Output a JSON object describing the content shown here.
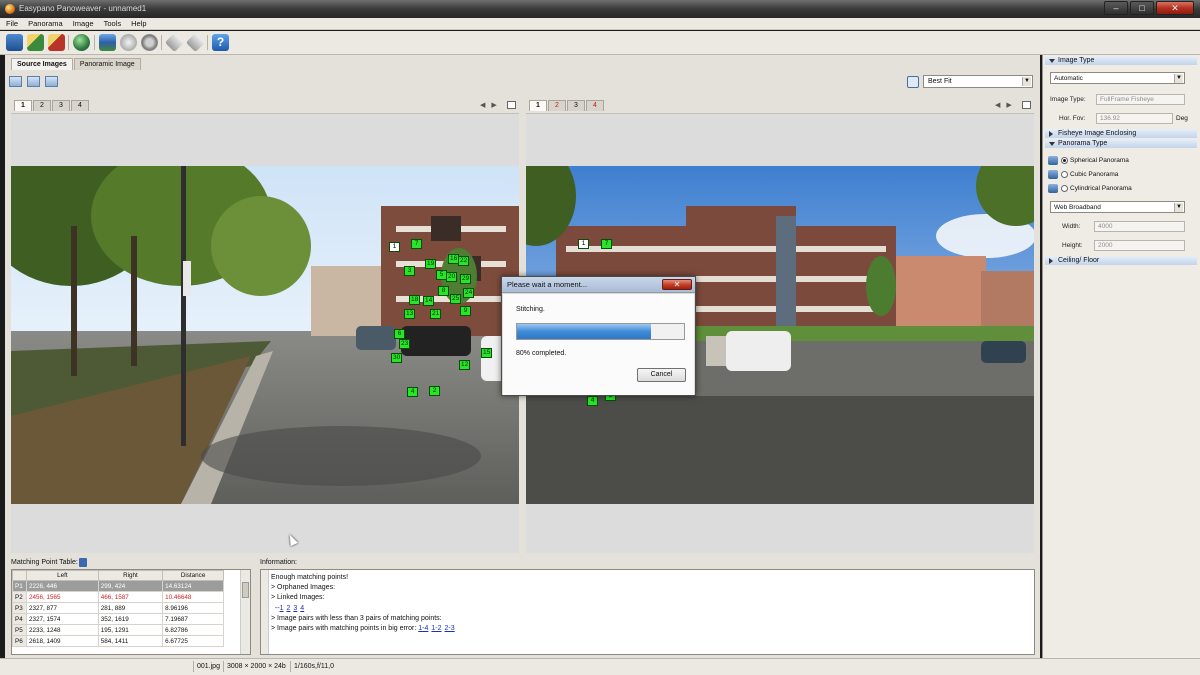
{
  "window": {
    "title": "Easypano Panoweaver - unnamed1",
    "minimize": "–",
    "maximize": "□",
    "close": "✕"
  },
  "menu": [
    "File",
    "Panorama",
    "Image",
    "Tools",
    "Help"
  ],
  "toolbar": {
    "icons": [
      "new-project-icon",
      "add-images-icon",
      "remove-images-icon",
      "detect-points-icon",
      "stitch-icon",
      "blend-icon",
      "publish-icon",
      "undo-icon",
      "redo-icon",
      "help-icon"
    ]
  },
  "tabs": {
    "source_images": "Source Images",
    "panoramic_image": "Panoramic Image"
  },
  "fit": {
    "value": "Best Fit"
  },
  "left_view": {
    "tabs": [
      "1",
      "2",
      "3",
      "4"
    ],
    "active": 0
  },
  "right_view": {
    "tabs": [
      "1",
      "2",
      "3",
      "4"
    ],
    "active": 0,
    "red_tabs": [
      1,
      3
    ]
  },
  "left_markers": [
    "1",
    "7",
    "3",
    "19",
    "16",
    "22",
    "5",
    "20",
    "29",
    "18",
    "14",
    "8",
    "24",
    "25",
    "13",
    "21",
    "9",
    "6",
    "23",
    "30",
    "15",
    "12",
    "4",
    "2"
  ],
  "right_markers": [
    "1",
    "7",
    "30",
    "6",
    "12",
    "4",
    "2"
  ],
  "dialog": {
    "title": "Please wait a moment...",
    "status": "Stitching.",
    "progress": 0.8,
    "percent_text": "80% completed.",
    "cancel": "Cancel",
    "close": "✕"
  },
  "matching_table": {
    "title": "Matching Point Table:",
    "headers": [
      "",
      "Left",
      "Right",
      "Distance"
    ],
    "rows": [
      [
        "P1",
        "2226, 446",
        "299, 424",
        "14.63124"
      ],
      [
        "P2",
        "2456, 1565",
        "466, 1587",
        "10.46648"
      ],
      [
        "P3",
        "2327, 877",
        "281, 889",
        "8.96196"
      ],
      [
        "P4",
        "2327, 1574",
        "352, 1619",
        "7.19687"
      ],
      [
        "P5",
        "2233, 1248",
        "195, 1291",
        "6.82786"
      ],
      [
        "P6",
        "2618, 1409",
        "584, 1411",
        "6.67725"
      ]
    ]
  },
  "information": {
    "title": "Information:",
    "lines": [
      "Enough matching points!",
      "> Orphaned Images:",
      "> Linked Images:",
      "--",
      "> Image pairs with less than 3 pairs of matching points:",
      "> Image pairs with matching points in big error:"
    ],
    "linked_images": [
      "1",
      "2",
      "3",
      "4"
    ],
    "error_pairs": [
      "1-4",
      "1-2",
      "2-3"
    ]
  },
  "right_panel": {
    "image_type_header": "Image Type",
    "image_type_select": "Automatic",
    "image_type_label": "Image Type:",
    "image_type_value": "FullFrame Fisheye",
    "hor_fov_label": "Hor. Fov:",
    "hor_fov_value": "136.92",
    "hor_fov_unit": "Deg",
    "fisheye_header": "Fisheye Image Enclosing",
    "pano_type_header": "Panorama Type",
    "pano_types": [
      "Spherical Panorama",
      "Cubic Panorama",
      "Cylindrical Panorama"
    ],
    "pano_selected": 0,
    "output_select": "Web Broadband",
    "width_label": "Width:",
    "width_value": "4000",
    "height_label": "Height:",
    "height_value": "2000",
    "ceiling_header": "Ceiling/ Floor"
  },
  "statusbar": {
    "file": "001.jpg",
    "dims": "3008 × 2000 × 24b",
    "exposure": "1/160s,f/11,0"
  }
}
